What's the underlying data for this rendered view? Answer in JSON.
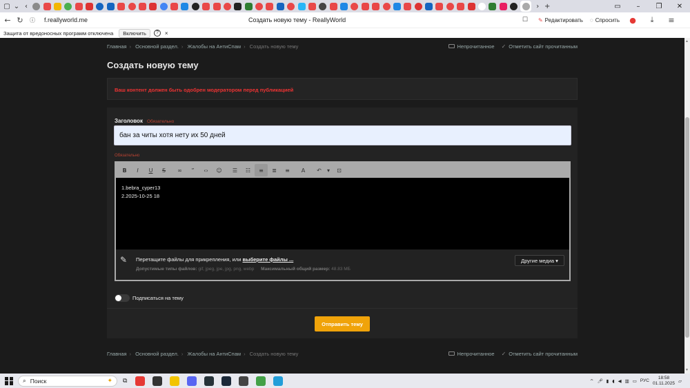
{
  "browser": {
    "url": "f.reallyworld.me",
    "page_title": "Создать новую тему - ReallyWorld",
    "edit_label": "Редактировать",
    "ask_label": "Спросить",
    "infobar": {
      "message": "Защита от вредоносных программ отключена",
      "enable_label": "Включить",
      "help": "?",
      "close": "×"
    },
    "tab_colors": [
      "#8a8a8a",
      "#e94848",
      "#f2b705",
      "#4caf50",
      "#e94848",
      "#d33",
      "#1565c0",
      "#1565c0",
      "#e94848",
      "#e94848",
      "#e94848",
      "#d33",
      "#4285f4",
      "#e94848",
      "#1e88e5",
      "#222",
      "#e94848",
      "#e94848",
      "#e94848",
      "#222",
      "#2e7d32",
      "#e94848",
      "#e94848",
      "#1565c0",
      "#e94848",
      "#29b6f6",
      "#e94848",
      "#444",
      "#e94848",
      "#1e88e5",
      "#e94848",
      "#e94848",
      "#e94848",
      "#e94848",
      "#1e88e5",
      "#e94848",
      "#d33",
      "#1565c0",
      "#e94848",
      "#e94848",
      "#e94848",
      "#d33",
      "#fff",
      "#2e7d32",
      "#e91e63",
      "#222"
    ]
  },
  "breadcrumbs": [
    "Главная",
    "Основной раздел.",
    "Жалобы на АнтиСпам",
    "Создать новую тему"
  ],
  "crumb_actions": {
    "unread": "Непрочитанное",
    "mark_read": "Отметить сайт прочитанным"
  },
  "page_heading": "Создать новую тему",
  "moderation_notice": "Ваш контент должен быть одобрен модератором перед публикацией",
  "form": {
    "title_label": "Заголовок",
    "required_text": "Обязательно",
    "title_value": "бан за читы хотя нету их 50 дней",
    "body_required_text": "Обязательно",
    "body_lines": [
      "1.bebra_cyper13",
      "2.2025-10-25 18"
    ],
    "attach_text": "Перетащите файлы для прикрепления, или ",
    "attach_link": "выберите файлы ...",
    "allowed_types_label": "Допустимые типы файлов:",
    "allowed_types": "gif, jpeg, jpe, jpg, png, webp",
    "max_size_label": "Максимальный общий размер:",
    "max_size": "48.83 МБ",
    "other_media": "Другие медиа",
    "subscribe_label": "Подписаться на тему",
    "submit_label": "Отправить тему"
  },
  "taskbar": {
    "search_placeholder": "Поиск",
    "lang": "РУС",
    "time": "18:58",
    "date": "01.11.2025",
    "app_colors": [
      "#e53935",
      "#333",
      "#f2c400",
      "#5865f2",
      "#263238",
      "#1b2838",
      "#444",
      "#43a047",
      "#229ed9"
    ]
  },
  "colors": {
    "accent": "#f0a30a",
    "notice": "#ee3333",
    "input_bg": "#e8f0fe"
  }
}
